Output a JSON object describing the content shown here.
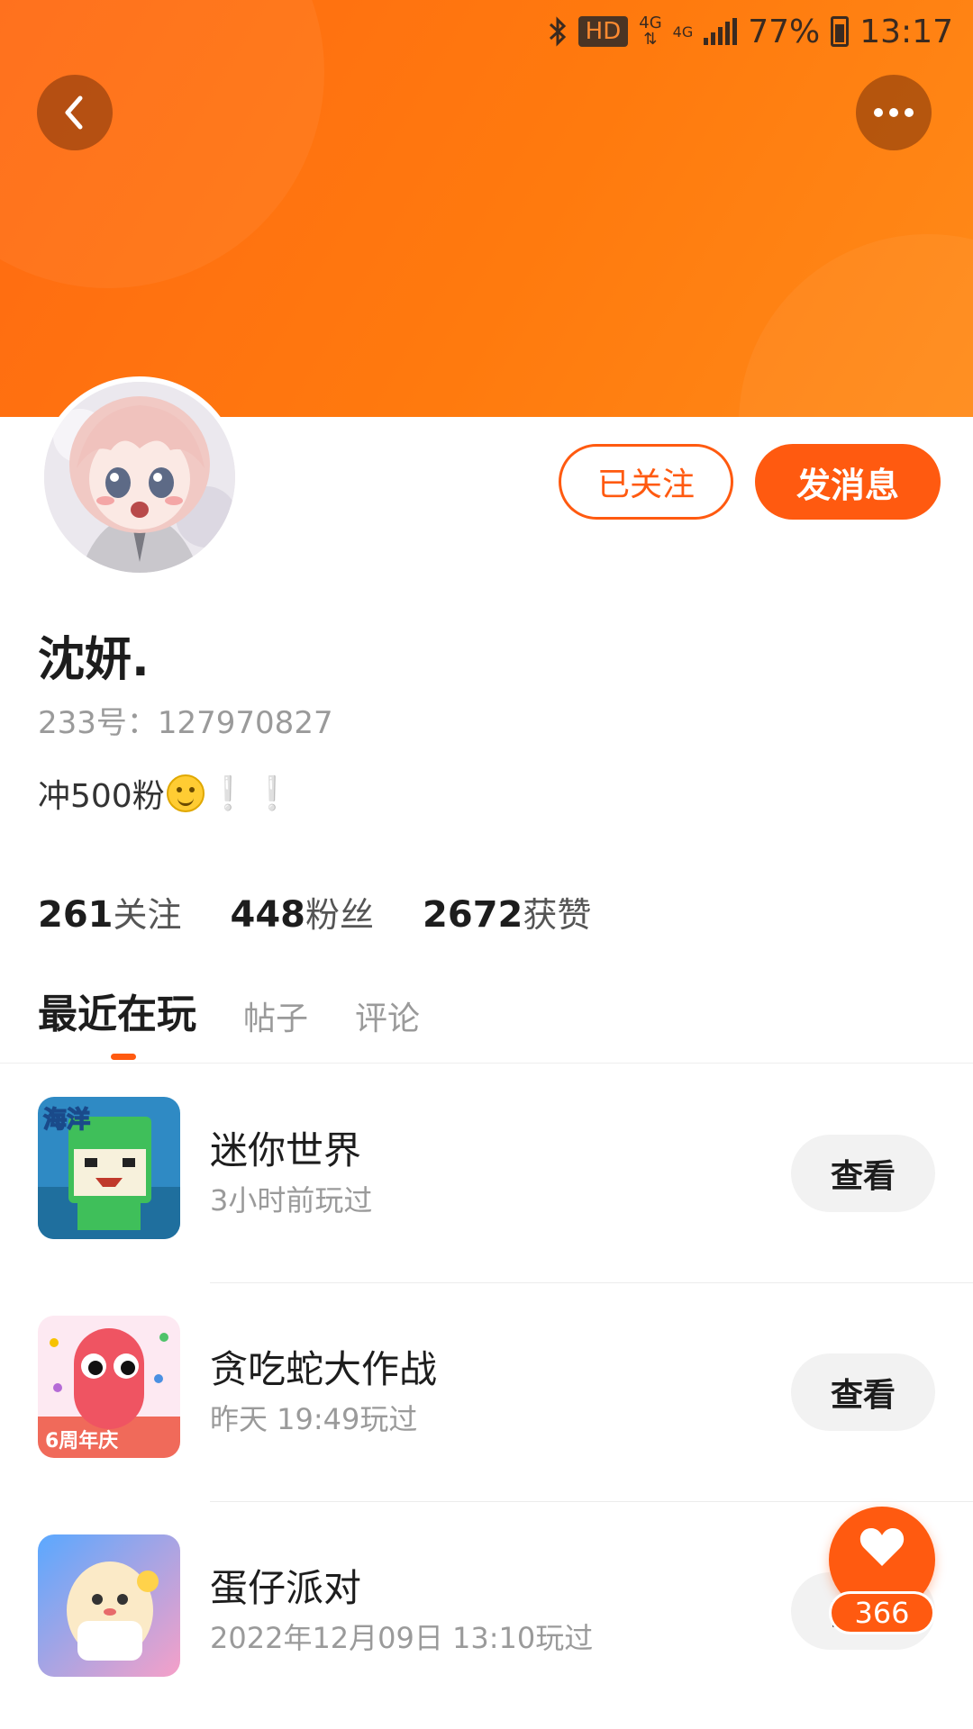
{
  "status_bar": {
    "hd": "HD",
    "net_top": "4G",
    "net_bottom": "4G",
    "battery": "77%",
    "time": "13:17"
  },
  "header": {
    "back_icon": "chevron-left-icon",
    "more_icon": "more-horizontal-icon",
    "banner_color": "#ff7410"
  },
  "profile": {
    "follow_label": "已关注",
    "message_label": "发消息",
    "name": "沈妍.",
    "id_text": "233号：127970827",
    "bio_text": "冲500粉",
    "bio_tail": "❕❕",
    "stats": [
      {
        "num": "261",
        "label": "关注"
      },
      {
        "num": "448",
        "label": "粉丝"
      },
      {
        "num": "2672",
        "label": "获赞"
      }
    ]
  },
  "tabs": [
    {
      "label": "最近在玩",
      "active": true
    },
    {
      "label": "帖子",
      "active": false
    },
    {
      "label": "评论",
      "active": false
    }
  ],
  "games": [
    {
      "title": "迷你世界",
      "time": "3小时前玩过",
      "button": "查看",
      "icon_text": "海洋"
    },
    {
      "title": "贪吃蛇大作战",
      "time": "昨天 19:49玩过",
      "button": "查看",
      "icon_text": "6周年庆"
    },
    {
      "title": "蛋仔派对",
      "time": "2022年12月09日 13:10玩过",
      "button": "查看"
    }
  ],
  "like": {
    "icon": "heart-icon",
    "count": "366"
  },
  "colors": {
    "accent": "#ff5a10",
    "muted": "#9a9a9a"
  }
}
